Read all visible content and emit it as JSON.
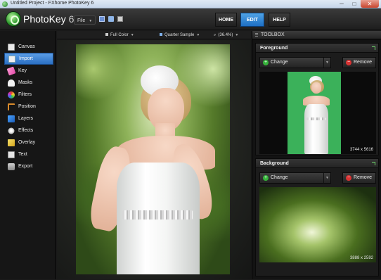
{
  "window": {
    "title": "Untitled Project - FXhome PhotoKey 6",
    "minimize": "─",
    "maximize": "□",
    "close": "✕"
  },
  "header": {
    "logo_name": "PhotoKey",
    "logo_version": "6",
    "file_menu": "File",
    "file_menu_icon": "chevron-down-icon",
    "toolbar_icons": [
      "save-icon",
      "open-icon",
      "print-icon"
    ],
    "nav": [
      {
        "label": "HOME",
        "active": false
      },
      {
        "label": "EDIT",
        "active": true
      },
      {
        "label": "HELP",
        "active": false
      }
    ],
    "accent_color": "#2b7bd1"
  },
  "sidebar": {
    "items": [
      {
        "label": "Canvas",
        "icon": "canvas-icon",
        "active": false
      },
      {
        "label": "Import",
        "icon": "import-icon",
        "active": true
      },
      {
        "label": "Key",
        "icon": "key-icon",
        "active": false
      },
      {
        "label": "Masks",
        "icon": "masks-icon",
        "active": false
      },
      {
        "label": "Filters",
        "icon": "filters-icon",
        "active": false
      },
      {
        "label": "Position",
        "icon": "position-icon",
        "active": false
      },
      {
        "label": "Layers",
        "icon": "layers-icon",
        "active": false
      },
      {
        "label": "Effects",
        "icon": "effects-icon",
        "active": false
      },
      {
        "label": "Overlay",
        "icon": "overlay-icon",
        "active": false
      },
      {
        "label": "Text",
        "icon": "text-icon",
        "active": false
      },
      {
        "label": "Export",
        "icon": "export-icon",
        "active": false
      }
    ]
  },
  "stage": {
    "view_mode": "Full Color",
    "sample_mode": "Quarter Sample",
    "zoom": "(36.4%)"
  },
  "toolbox": {
    "title": "TOOLBOX",
    "foreground": {
      "title": "Foreground",
      "change_label": "Change",
      "remove_label": "Remove",
      "dimensions": "3744 x 5616",
      "key_color": "#3bb15a"
    },
    "background": {
      "title": "Background",
      "change_label": "Change",
      "remove_label": "Remove",
      "dimensions": "3888 x 2592"
    }
  }
}
